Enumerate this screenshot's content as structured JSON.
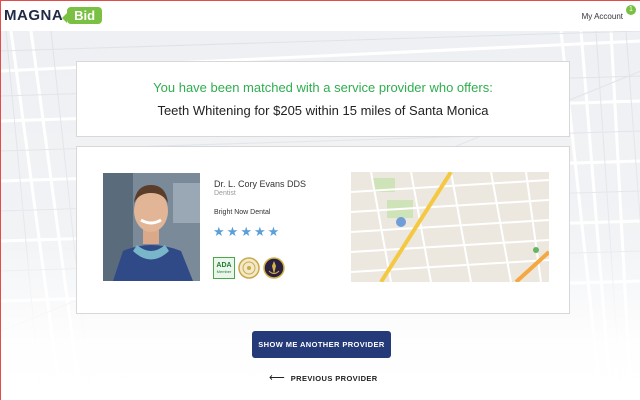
{
  "header": {
    "logo_text": "MAGNA",
    "logo_badge": "Bid",
    "account_label": "My Account",
    "notification_count": "1"
  },
  "match": {
    "headline": "You have been matched with a service provider who offers:",
    "service": "Teeth Whitening",
    "word_for": "for",
    "price": "$205",
    "word_within": "within",
    "distance": "15 miles",
    "word_of": "of",
    "location": "Santa Monica"
  },
  "provider": {
    "name": "Dr. L. Cory Evans DDS",
    "title": "Dentist",
    "practice": "Bright Now Dental",
    "rating": 5,
    "rating_max": 5,
    "badges": {
      "ada_label": "ADA",
      "ada_sub": "Member"
    }
  },
  "actions": {
    "primary_label": "SHOW ME ANOTHER PROVIDER",
    "prev_label": "PREVIOUS PROVIDER"
  },
  "colors": {
    "brand_green": "#7ac043",
    "match_green": "#2eae4f",
    "button_navy": "#253a78",
    "star_blue": "#5b9fd8"
  },
  "icons": {
    "rating": "star-icon",
    "back": "arrow-left-icon",
    "map_pin": "location-pin-icon"
  }
}
